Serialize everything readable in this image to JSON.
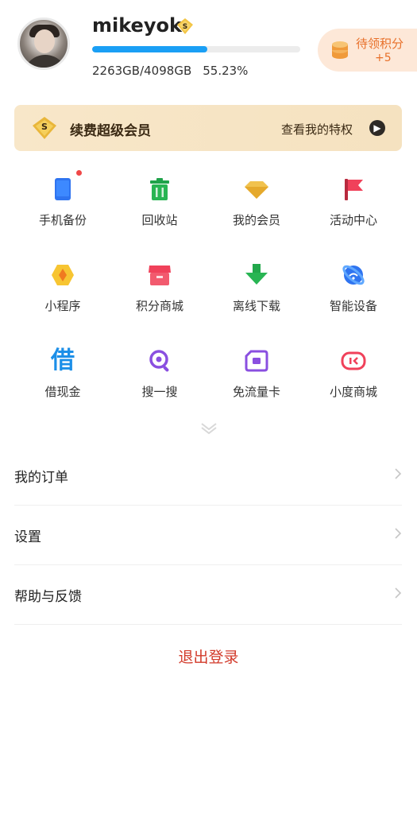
{
  "profile": {
    "username": "mikeyok",
    "storage_used": "2263GB/4098GB",
    "storage_percent": "55.23%",
    "progress_fraction": 0.5523
  },
  "points": {
    "label": "待领积分",
    "delta": "+5"
  },
  "vip": {
    "title": "续费超级会员",
    "link": "查看我的特权"
  },
  "grid": [
    {
      "label": "手机备份",
      "icon": "phone-backup-icon",
      "badge": true
    },
    {
      "label": "回收站",
      "icon": "trash-icon"
    },
    {
      "label": "我的会员",
      "icon": "diamond-icon"
    },
    {
      "label": "活动中心",
      "icon": "flag-icon"
    },
    {
      "label": "小程序",
      "icon": "mini-program-icon"
    },
    {
      "label": "积分商城",
      "icon": "store-icon"
    },
    {
      "label": "离线下载",
      "icon": "download-icon"
    },
    {
      "label": "智能设备",
      "icon": "smart-device-icon"
    },
    {
      "label": "借现金",
      "icon": "borrow-cash-icon",
      "glyph": "借"
    },
    {
      "label": "搜一搜",
      "icon": "search-icon"
    },
    {
      "label": "免流量卡",
      "icon": "sim-card-icon"
    },
    {
      "label": "小度商城",
      "icon": "xiaodu-store-icon"
    }
  ],
  "menu": [
    {
      "label": "我的订单"
    },
    {
      "label": "设置"
    },
    {
      "label": "帮助与反馈"
    }
  ],
  "logout": "退出登录",
  "colors": {
    "accent_blue": "#1a9ff5",
    "points_orange": "#e8702a",
    "logout_red": "#d23a2a",
    "vip_bg": "#f8e7c9"
  }
}
